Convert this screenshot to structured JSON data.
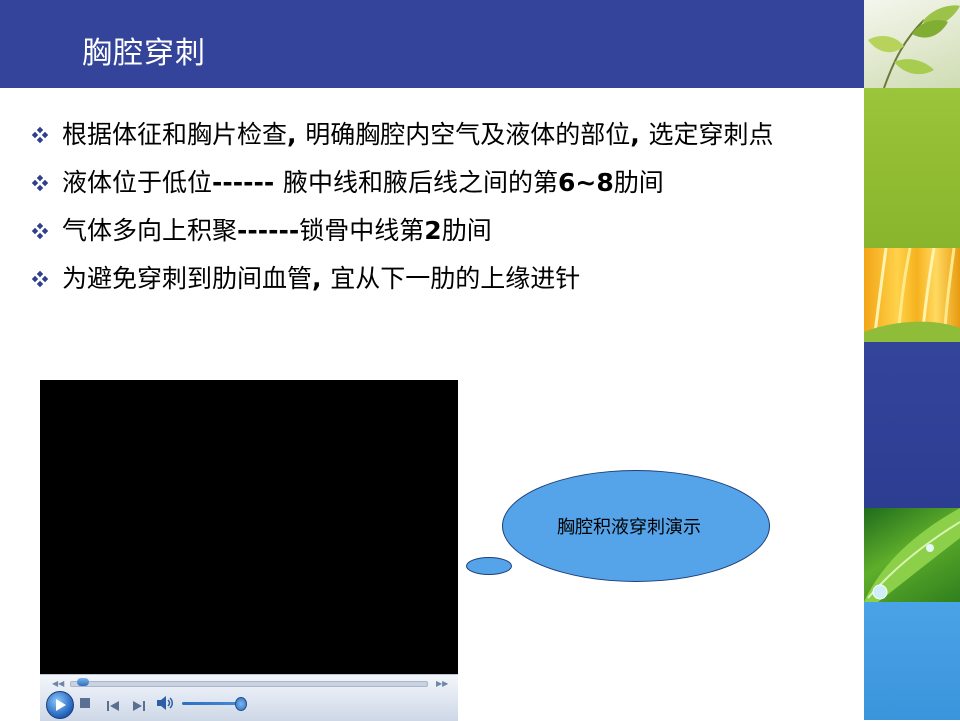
{
  "slide": {
    "title": "胸腔穿刺"
  },
  "bullets": [
    {
      "segments": [
        {
          "text": "根据体征和胸片检查",
          "bold": false
        },
        {
          "text": ", ",
          "bold": true
        },
        {
          "text": "明确胸腔内空气及液体的部位",
          "bold": false
        },
        {
          "text": ", ",
          "bold": true
        },
        {
          "text": "选定穿刺点",
          "bold": false
        }
      ]
    },
    {
      "segments": [
        {
          "text": "液体位于低位",
          "bold": false
        },
        {
          "text": "------ ",
          "bold": true
        },
        {
          "text": "腋中线和腋后线之间的第",
          "bold": false
        },
        {
          "text": "6~8",
          "bold": true
        },
        {
          "text": "肋间",
          "bold": false
        }
      ]
    },
    {
      "segments": [
        {
          "text": "气体多向上积聚",
          "bold": false
        },
        {
          "text": "------",
          "bold": true
        },
        {
          "text": "锁骨中线第",
          "bold": false
        },
        {
          "text": "2",
          "bold": true
        },
        {
          "text": "肋间",
          "bold": false
        }
      ]
    },
    {
      "segments": [
        {
          "text": "为避免穿刺到肋间血管",
          "bold": false
        },
        {
          "text": ", ",
          "bold": true
        },
        {
          "text": "宜从下一肋的上缘进针",
          "bold": false
        }
      ]
    }
  ],
  "callout": {
    "text": "胸腔积液穿刺演示"
  },
  "player": {
    "seek_progress": 0.02,
    "volume_level": 0.9
  },
  "icons": {
    "bullet": "diamond-bullet-icon",
    "play": "play-icon",
    "stop": "stop-icon",
    "previous": "previous-icon",
    "next": "next-icon",
    "volume": "speaker-icon"
  },
  "colors": {
    "title_bar": "#34449a",
    "bullet_icon": "#2f3f8f",
    "callout_fill": "#55a3e8",
    "green_panel": "#9bc53a",
    "orange_panel": "#f6b21e",
    "light_blue_panel": "#4aa3e6"
  }
}
